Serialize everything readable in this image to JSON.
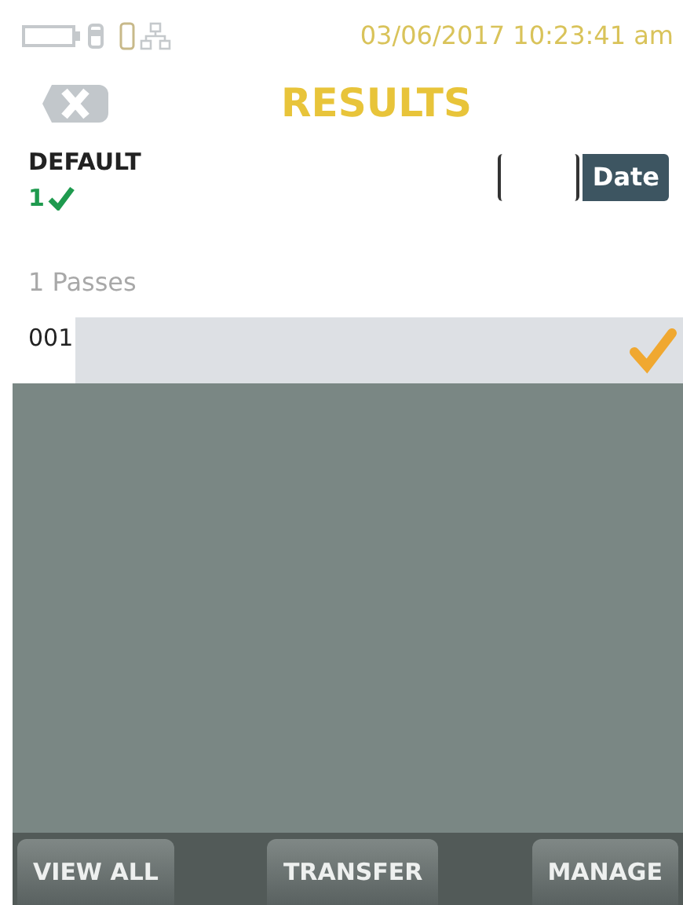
{
  "status_bar": {
    "datetime": "03/06/2017 10:23:41 am"
  },
  "header": {
    "title": "RESULTS"
  },
  "group": {
    "name": "DEFAULT",
    "pass_count": "1",
    "summary": "1 Passes"
  },
  "sort": {
    "button": "Date"
  },
  "rows": [
    {
      "id": "001",
      "selected": true,
      "passed": true
    }
  ],
  "buttons": [
    "VIEW ALL",
    "TRANSFER",
    "MANAGE"
  ]
}
